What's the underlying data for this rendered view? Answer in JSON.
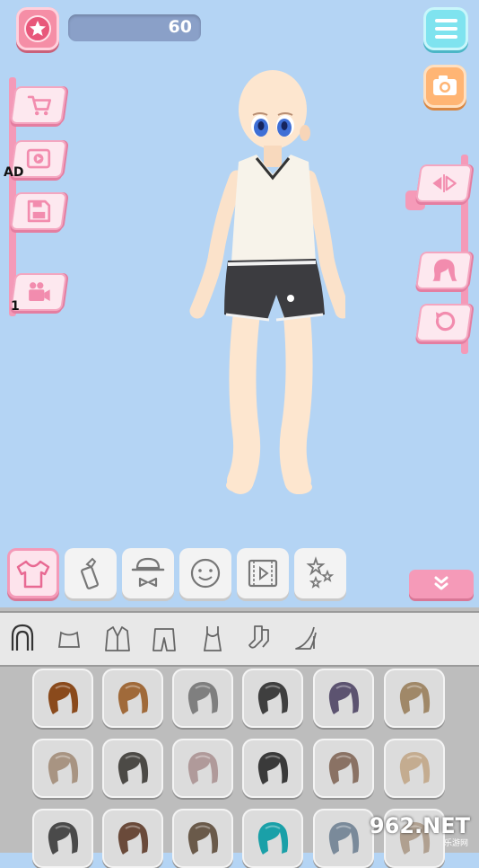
{
  "top": {
    "coins": "60",
    "favorites_icon": "star-icon",
    "menu_icon": "hamburger-icon",
    "camera_icon": "camera-icon"
  },
  "left_actions": [
    {
      "name": "shop",
      "icon": "cart-icon"
    },
    {
      "name": "watch-ad",
      "icon": "video-play-icon",
      "label": "AD"
    },
    {
      "name": "save",
      "icon": "floppy-disk-icon"
    },
    {
      "name": "record",
      "icon": "video-camera-icon",
      "label": "1"
    }
  ],
  "right_actions": [
    {
      "name": "flip-pose",
      "icon": "flip-arrows-icon"
    },
    {
      "name": "hair-style",
      "icon": "hair-icon"
    },
    {
      "name": "reset",
      "icon": "rotate-icon"
    }
  ],
  "categories": [
    {
      "name": "clothing",
      "icon": "tshirt-icon",
      "active": true
    },
    {
      "name": "makeup",
      "icon": "lipstick-icon"
    },
    {
      "name": "accessories",
      "icon": "hat-bowtie-icon"
    },
    {
      "name": "face",
      "icon": "smiley-face-icon"
    },
    {
      "name": "animation",
      "icon": "film-icon"
    },
    {
      "name": "effects",
      "icon": "stars-icon"
    }
  ],
  "subcategories": [
    {
      "name": "hair",
      "icon": "hair-outline-icon",
      "active": true
    },
    {
      "name": "top",
      "icon": "crop-top-icon"
    },
    {
      "name": "jacket",
      "icon": "jacket-icon"
    },
    {
      "name": "pants",
      "icon": "shorts-icon"
    },
    {
      "name": "tank",
      "icon": "tank-top-icon"
    },
    {
      "name": "socks",
      "icon": "socks-icon"
    },
    {
      "name": "shoes",
      "icon": "high-heel-icon"
    }
  ],
  "hair_items": [
    {
      "color": "#8a4a1c"
    },
    {
      "color": "#a06a3a"
    },
    {
      "color": "#7f7f7f"
    },
    {
      "color": "#3f3f3f"
    },
    {
      "color": "#5c5370"
    },
    {
      "color": "#a08868"
    },
    {
      "color": "#a89482"
    },
    {
      "color": "#4c4a46"
    },
    {
      "color": "#b09a9a"
    },
    {
      "color": "#3a3a3a"
    },
    {
      "color": "#8a7264"
    },
    {
      "color": "#c4ac90"
    },
    {
      "color": "#4a4a4a"
    },
    {
      "color": "#6a4a3a"
    },
    {
      "color": "#6a5a4a"
    },
    {
      "color": "#1aa0a8"
    },
    {
      "color": "#7a8a9a"
    },
    {
      "color": "#b0a090"
    }
  ],
  "watermark": {
    "main": "962.NET",
    "sub": "乐游网"
  },
  "colors": {
    "background": "#b4d4f4",
    "accent_pink": "#f49ab8",
    "menu_cyan": "#7fe3ef",
    "camera_orange": "#ffb574"
  }
}
